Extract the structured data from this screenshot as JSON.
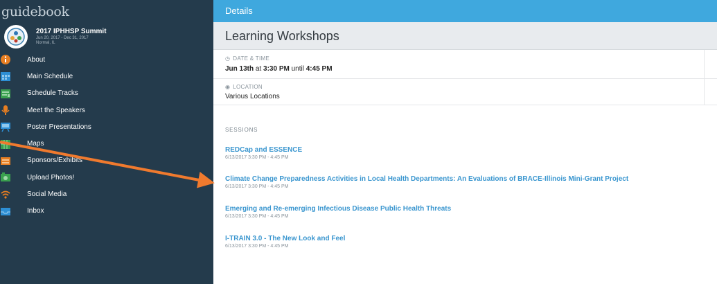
{
  "sidebar": {
    "brand": "guidebook",
    "event": {
      "title": "2017 IPHHSP Summit",
      "dates": "Jun 20, 2017 - Dec 31, 2017",
      "location": "Normal, IL"
    },
    "items": [
      {
        "label": "About",
        "icon": "info-icon"
      },
      {
        "label": "Main Schedule",
        "icon": "calendar-icon"
      },
      {
        "label": "Schedule Tracks",
        "icon": "tracks-icon"
      },
      {
        "label": "Meet the Speakers",
        "icon": "speaker-icon"
      },
      {
        "label": "Poster Presentations",
        "icon": "poster-icon"
      },
      {
        "label": "Maps",
        "icon": "map-icon"
      },
      {
        "label": "Sponsors/Exhibits",
        "icon": "sponsors-icon"
      },
      {
        "label": "Upload Photos!",
        "icon": "photo-icon"
      },
      {
        "label": "Social Media",
        "icon": "wifi-icon"
      },
      {
        "label": "Inbox",
        "icon": "inbox-icon"
      }
    ]
  },
  "main": {
    "header": "Details",
    "title": "Learning Workshops",
    "datetime": {
      "label": "DATE & TIME",
      "date": "Jun 13th",
      "at": "at",
      "start": "3:30 PM",
      "until": "until",
      "end": "4:45 PM"
    },
    "location": {
      "label": "LOCATION",
      "value": "Various Locations"
    },
    "sessions_label": "SESSIONS",
    "sessions": [
      {
        "title": "REDCap and ESSENCE",
        "time": "6/13/2017 3:30 PM - 4:45 PM"
      },
      {
        "title": "Climate Change Preparedness Activities in Local Health Departments: An Evaluations of BRACE-Illinois Mini-Grant Project",
        "time": "6/13/2017 3:30 PM - 4:45 PM"
      },
      {
        "title": "Emerging and Re-emerging Infectious Disease Public Health Threats",
        "time": "6/13/2017 3:30 PM - 4:45 PM"
      },
      {
        "title": "I-TRAIN 3.0 - The New Look and Feel",
        "time": "6/13/2017 3:30 PM - 4:45 PM"
      }
    ]
  },
  "colors": {
    "sidebar_bg": "#243b4c",
    "header_blue": "#3fa8de",
    "link_blue": "#3a96cf",
    "arrow_orange": "#f07a2e"
  }
}
